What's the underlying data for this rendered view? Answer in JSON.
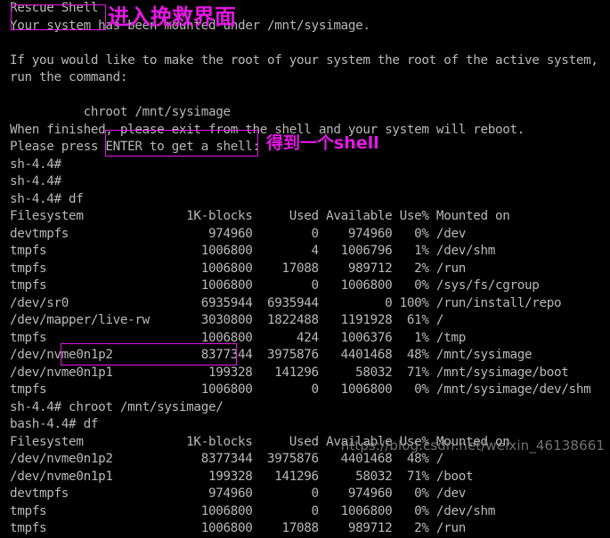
{
  "annotations": {
    "color": "#e617e6",
    "rescue_shell_box_label": "Rescue Shell",
    "title_cn": "进入挽救界面",
    "shell_cn": "得到一个shell",
    "enter_box_label": "ENTER to get a shell:",
    "chroot_box_label": "chroot /mnt/sysimage/"
  },
  "watermark": {
    "text": "https://blog.csdn.net/weixin_46138661"
  },
  "terminal": {
    "foreground": "#b8b8b8",
    "background": "#000000",
    "lines": [
      "Rescue Shell",
      "Your system has been mounted under /mnt/sysimage.",
      "",
      "If you would like to make the root of your system the root of the active system,",
      "run the command:",
      "",
      "          chroot /mnt/sysimage",
      "When finished, please exit from the shell and your system will reboot.",
      "Please press ENTER to get a shell:",
      "sh-4.4# ",
      "sh-4.4# ",
      "sh-4.4# df",
      "Filesystem              1K-blocks     Used Available Use% Mounted on",
      "devtmpfs                   974960        0    974960   0% /dev",
      "tmpfs                     1006800        4   1006796   1% /dev/shm",
      "tmpfs                     1006800    17088    989712   2% /run",
      "tmpfs                     1006800        0   1006800   0% /sys/fs/cgroup",
      "/dev/sr0                  6935944  6935944         0 100% /run/install/repo",
      "/dev/mapper/live-rw       3030800  1822488   1191928  61% /",
      "tmpfs                     1006800      424   1006376   1% /tmp",
      "/dev/nvme0n1p2            8377344  3975876   4401468  48% /mnt/sysimage",
      "/dev/nvme0n1p1             199328   141296     58032  71% /mnt/sysimage/boot",
      "tmpfs                     1006800        0   1006800   0% /mnt/sysimage/dev/shm",
      "sh-4.4# chroot /mnt/sysimage/",
      "bash-4.4# df",
      "Filesystem              1K-blocks     Used Available Use% Mounted on",
      "/dev/nvme0n1p2            8377344  3975876   4401468  48% /",
      "/dev/nvme0n1p1             199328   141296     58032  71% /boot",
      "devtmpfs                   974960        0    974960   0% /dev",
      "tmpfs                     1006800        0   1006800   0% /dev/shm",
      "tmpfs                     1006800    17088    989712   2% /run"
    ]
  },
  "df_tables": [
    {
      "command": "df",
      "prompt": "sh-4.4#",
      "columns": [
        "Filesystem",
        "1K-blocks",
        "Used",
        "Available",
        "Use%",
        "Mounted on"
      ],
      "rows": [
        [
          "devtmpfs",
          "974960",
          "0",
          "974960",
          "0%",
          "/dev"
        ],
        [
          "tmpfs",
          "1006800",
          "4",
          "1006796",
          "1%",
          "/dev/shm"
        ],
        [
          "tmpfs",
          "1006800",
          "17088",
          "989712",
          "2%",
          "/run"
        ],
        [
          "tmpfs",
          "1006800",
          "0",
          "1006800",
          "0%",
          "/sys/fs/cgroup"
        ],
        [
          "/dev/sr0",
          "6935944",
          "6935944",
          "0",
          "100%",
          "/run/install/repo"
        ],
        [
          "/dev/mapper/live-rw",
          "3030800",
          "1822488",
          "1191928",
          "61%",
          "/"
        ],
        [
          "tmpfs",
          "1006800",
          "424",
          "1006376",
          "1%",
          "/tmp"
        ],
        [
          "/dev/nvme0n1p2",
          "8377344",
          "3975876",
          "4401468",
          "48%",
          "/mnt/sysimage"
        ],
        [
          "/dev/nvme0n1p1",
          "199328",
          "141296",
          "58032",
          "71%",
          "/mnt/sysimage/boot"
        ],
        [
          "tmpfs",
          "1006800",
          "0",
          "1006800",
          "0%",
          "/mnt/sysimage/dev/shm"
        ]
      ]
    },
    {
      "command": "df",
      "prompt": "bash-4.4#",
      "columns": [
        "Filesystem",
        "1K-blocks",
        "Used",
        "Available",
        "Use%",
        "Mounted on"
      ],
      "rows": [
        [
          "/dev/nvme0n1p2",
          "8377344",
          "3975876",
          "4401468",
          "48%",
          "/"
        ],
        [
          "/dev/nvme0n1p1",
          "199328",
          "141296",
          "58032",
          "71%",
          "/boot"
        ],
        [
          "devtmpfs",
          "974960",
          "0",
          "974960",
          "0%",
          "/dev"
        ],
        [
          "tmpfs",
          "1006800",
          "0",
          "1006800",
          "0%",
          "/dev/shm"
        ],
        [
          "tmpfs",
          "1006800",
          "17088",
          "989712",
          "2%",
          "/run"
        ]
      ]
    }
  ]
}
